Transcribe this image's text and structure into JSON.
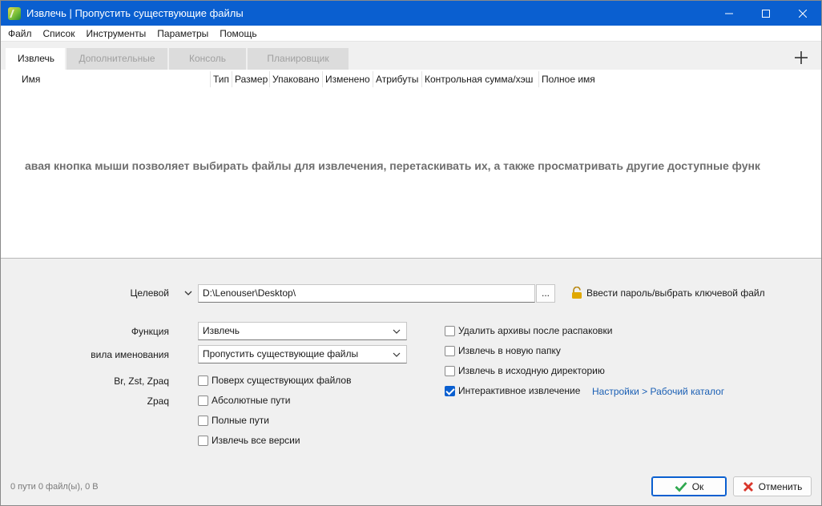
{
  "window": {
    "title": "Извлечь | Пропустить существующие файлы"
  },
  "menu": [
    "Файл",
    "Список",
    "Инструменты",
    "Параметры",
    "Помощь"
  ],
  "tabs": [
    {
      "label": "Извлечь",
      "active": true
    },
    {
      "label": "Дополнительные",
      "active": false
    },
    {
      "label": "Консоль",
      "active": false
    },
    {
      "label": "Планировщик",
      "active": false
    }
  ],
  "file_list": {
    "columns": [
      "Имя",
      "Тип",
      "Размер",
      "Упаковано",
      "Изменено",
      "Атрибуты",
      "Контрольная сумма/хэш",
      "Полное имя"
    ],
    "hint": "авая кнопка мыши позволяет выбирать файлы для извлечения, перетаскивать их, а также просматривать другие доступные функ"
  },
  "destination": {
    "label": "Целевой",
    "value": "D:\\Lenouser\\Desktop\\",
    "browse_label": "...",
    "password_label": "Ввести пароль/выбрать ключевой файл"
  },
  "function": {
    "label": "Функция",
    "value": "Извлечь"
  },
  "naming": {
    "label": "вила именования",
    "value": "Пропустить существующие файлы"
  },
  "labels": {
    "br": "Br, Zst, Zpaq",
    "zpaq": "Zpaq"
  },
  "options_left": [
    {
      "label": "Поверх существующих файлов",
      "checked": false
    },
    {
      "label": "Абсолютные пути",
      "checked": false
    },
    {
      "label": "Полные пути",
      "checked": false
    },
    {
      "label": "Извлечь все версии",
      "checked": false
    }
  ],
  "options_right": [
    {
      "label": "Удалить архивы после распаковки",
      "checked": false
    },
    {
      "label": "Извлечь в новую папку",
      "checked": false
    },
    {
      "label": "Извлечь в исходную директорию",
      "checked": false
    },
    {
      "label": "Интерактивное извлечение",
      "checked": true
    }
  ],
  "settings_link": "Настройки > Рабочий каталог",
  "status": "0 пути 0 файл(ы), 0 B",
  "buttons": {
    "ok": "Ок",
    "cancel": "Отменить"
  },
  "colors": {
    "accent": "#0a5fd0",
    "ok_icon": "#2fa84f",
    "cancel_icon": "#d9362b",
    "link": "#1a5fb4",
    "lock": "#e0a800"
  }
}
